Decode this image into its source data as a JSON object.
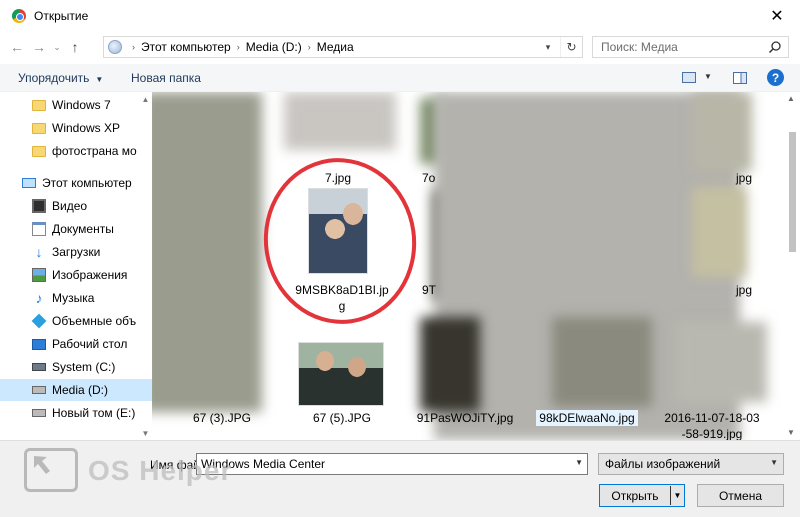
{
  "window": {
    "title": "Открытие",
    "close_glyph": "✕"
  },
  "nav": {
    "back": "←",
    "forward": "→",
    "recent": "⌄",
    "up": "↑",
    "breadcrumbs": [
      "Этот компьютер",
      "Media (D:)",
      "Медиа"
    ],
    "search_placeholder": "Поиск: Медиа"
  },
  "toolbar": {
    "organize": "Упорядочить",
    "new_folder": "Новая папка",
    "help": "?"
  },
  "sidebar": {
    "items": [
      {
        "label": "Windows 7",
        "icon": "folder-icon"
      },
      {
        "label": "Windows XP",
        "icon": "folder-icon"
      },
      {
        "label": "фотострана мо",
        "icon": "folder-icon"
      },
      {
        "label": "Этот компьютер",
        "icon": "computer-icon"
      },
      {
        "label": "Видео",
        "icon": "video-icon"
      },
      {
        "label": "Документы",
        "icon": "documents-icon"
      },
      {
        "label": "Загрузки",
        "icon": "downloads-icon"
      },
      {
        "label": "Изображения",
        "icon": "pictures-icon"
      },
      {
        "label": "Музыка",
        "icon": "music-icon"
      },
      {
        "label": "Объемные объ",
        "icon": "3d-objects-icon"
      },
      {
        "label": "Рабочий стол",
        "icon": "desktop-icon"
      },
      {
        "label": "System (C:)",
        "icon": "drive-icon"
      },
      {
        "label": "Media (D:)",
        "icon": "drive-icon",
        "selected": true
      },
      {
        "label": "Новый том (E:)",
        "icon": "drive-icon"
      }
    ]
  },
  "files": {
    "names": {
      "f7": "7.jpg",
      "f7o": "7o",
      "fjpg_right": "jpg",
      "f9msbk_1": "9MSBK8aD1BI.jp",
      "f9msbk_2": "g",
      "f9t": "9T",
      "fjpg_right2": "jpg",
      "f67_3": "67 (3).JPG",
      "f67_5": "67 (5).JPG",
      "f91pas": "91PasWOJiTY.jpg",
      "f98kd": "98kDElwaaNo.jpg",
      "f2016_1": "2016-11-07-18-03",
      "f2016_2": "-58-919.jpg"
    },
    "highlighted_annotation": "red-circle"
  },
  "bottom": {
    "filename_label": "Имя файла:",
    "filename_value": "Windows Media Center",
    "filetype_value": "Файлы изображений",
    "open_label": "Открыть",
    "cancel_label": "Отмена"
  },
  "watermark": {
    "text": "OS Helper"
  },
  "colors": {
    "selection": "#cce8ff",
    "accent": "#0078d7",
    "annotation": "#e2343a"
  }
}
